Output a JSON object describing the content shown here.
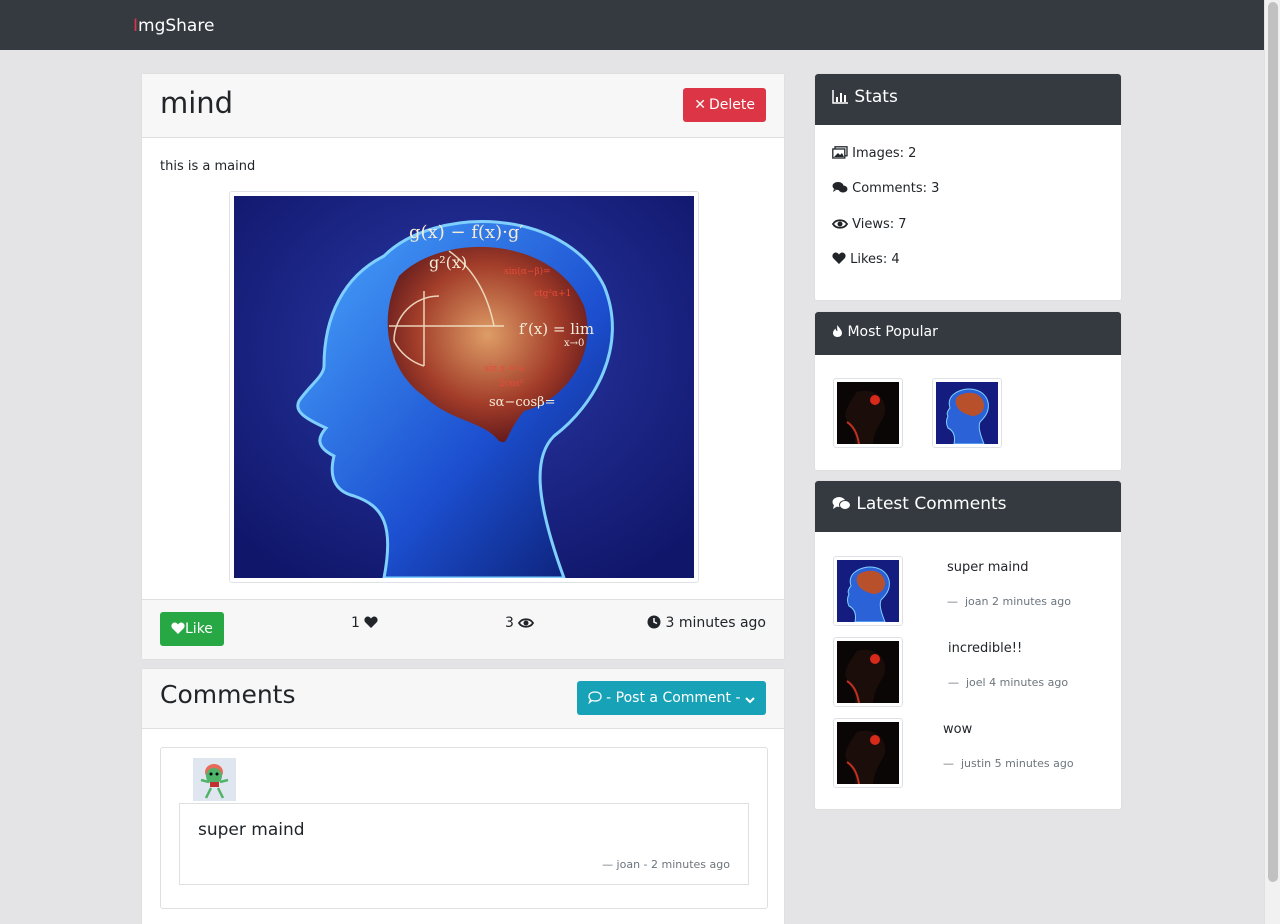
{
  "navbar": {
    "brand_first": "I",
    "brand_rest": "mgShare"
  },
  "image": {
    "title": "mind",
    "delete_label": "Delete",
    "description": "this is a maind",
    "like_label": "Like",
    "likes": "1",
    "views": "3",
    "time": "3 minutes ago"
  },
  "comments": {
    "title": "Comments",
    "post_label": "- Post a Comment -",
    "items": [
      {
        "text": "super maind",
        "meta": "— joan - 2 minutes ago"
      }
    ]
  },
  "sidebar": {
    "stats": {
      "title": "Stats",
      "images": "Images: 2",
      "comments": "Comments: 3",
      "views": "Views: 7",
      "likes": "Likes: 4"
    },
    "popular": {
      "title": "Most Popular"
    },
    "latest": {
      "title": "Latest Comments",
      "items": [
        {
          "text": "super maind",
          "meta": "joan 2 minutes ago"
        },
        {
          "text": "incredible!!",
          "meta": "joel 4 minutes ago"
        },
        {
          "text": "wow",
          "meta": "justin 5 minutes ago"
        }
      ]
    }
  },
  "colors": {
    "navbar": "#343a40",
    "danger": "#dc3545",
    "success": "#28a745",
    "info": "#17a2b8"
  },
  "icons": [
    "times-icon",
    "heart-icon",
    "eye-icon",
    "clock-icon",
    "comment-icon",
    "chevron-down-icon",
    "bar-chart-icon",
    "images-icon",
    "comments-icon",
    "fire-icon"
  ]
}
